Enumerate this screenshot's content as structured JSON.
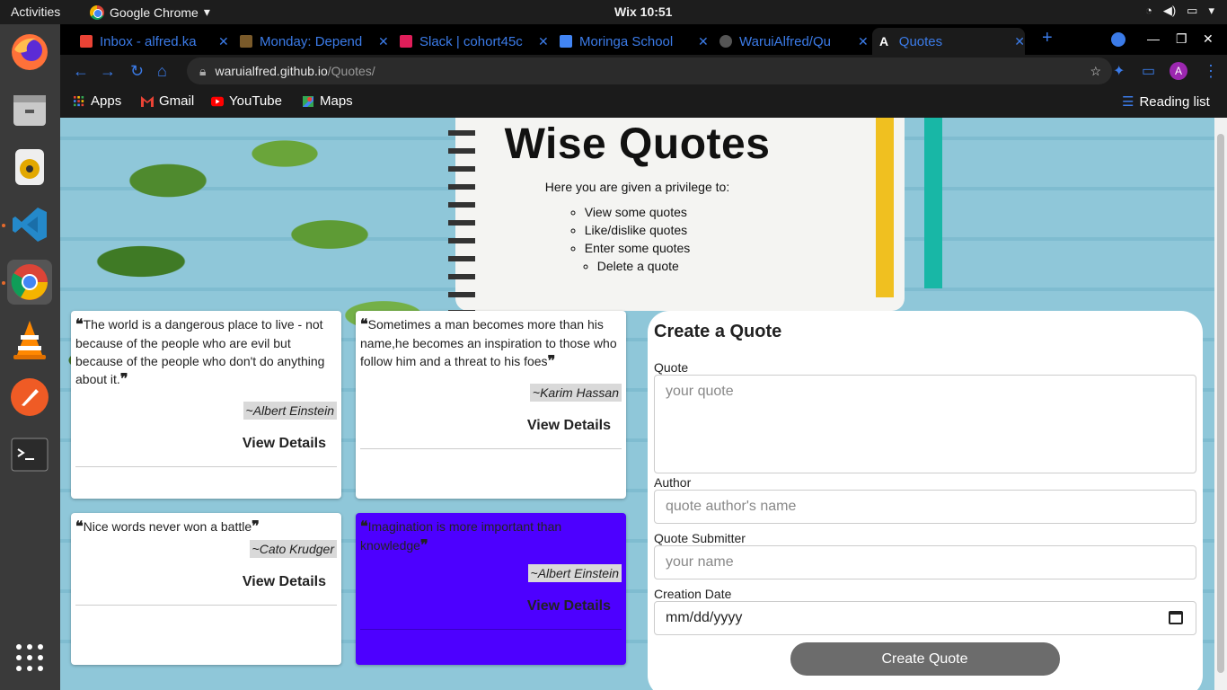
{
  "system": {
    "activities": "Activities",
    "app_name": "Google Chrome",
    "clock": "Wix 10:51"
  },
  "browser": {
    "tabs": [
      {
        "title": "Inbox - alfred.ka",
        "color": "#ea4335"
      },
      {
        "title": "Monday: Depend",
        "color": "#7a5a2a"
      },
      {
        "title": "Slack | cohort45c",
        "color": "#e01e5a"
      },
      {
        "title": "Moringa School",
        "color": "#4285f4"
      },
      {
        "title": "WaruiAlfred/Qu",
        "color": "#555555"
      },
      {
        "title": "Quotes",
        "color": "#ffffff"
      }
    ],
    "new_tab": "+",
    "url_host": "waruialfred.github.io",
    "url_path": "/Quotes/",
    "bookmarks": [
      {
        "label": "Apps"
      },
      {
        "label": "Gmail"
      },
      {
        "label": "YouTube"
      },
      {
        "label": "Maps"
      }
    ],
    "reading_list": "Reading list",
    "profile_initial": "A"
  },
  "page": {
    "title": "Wise Quotes",
    "intro": "Here you are given a privilege to:",
    "privileges": [
      "View some quotes",
      "Like/dislike quotes",
      "Enter some quotes",
      "Delete a quote"
    ],
    "quotes": [
      {
        "text": "The world is a dangerous place to live - not because of the people who are evil but because of the people who don't do anything about it.",
        "author": "~Albert Einstein",
        "details": "View Details"
      },
      {
        "text": "Sometimes a man becomes more than his name,he becomes an inspiration to those who follow him and a threat to his foes",
        "author": "~Karim Hassan",
        "details": "View Details"
      },
      {
        "text": "Nice words never won a battle",
        "author": "~Cato Krudger",
        "details": "View Details"
      },
      {
        "text": "Imagination is more important than knowledge",
        "author": "~Albert Einstein",
        "details": "View Details"
      }
    ],
    "open_quote": "❝",
    "close_quote": "❞",
    "form": {
      "heading": "Create a Quote",
      "quote_label": "Quote",
      "quote_placeholder": "your quote",
      "author_label": "Author",
      "author_placeholder": "quote author's name",
      "submitter_label": "Quote Submitter",
      "submitter_placeholder": "your name",
      "date_label": "Creation Date",
      "date_placeholder": "mm/dd/yyyy",
      "submit": "Create Quote"
    },
    "highlight_color": "#4d00ff"
  }
}
